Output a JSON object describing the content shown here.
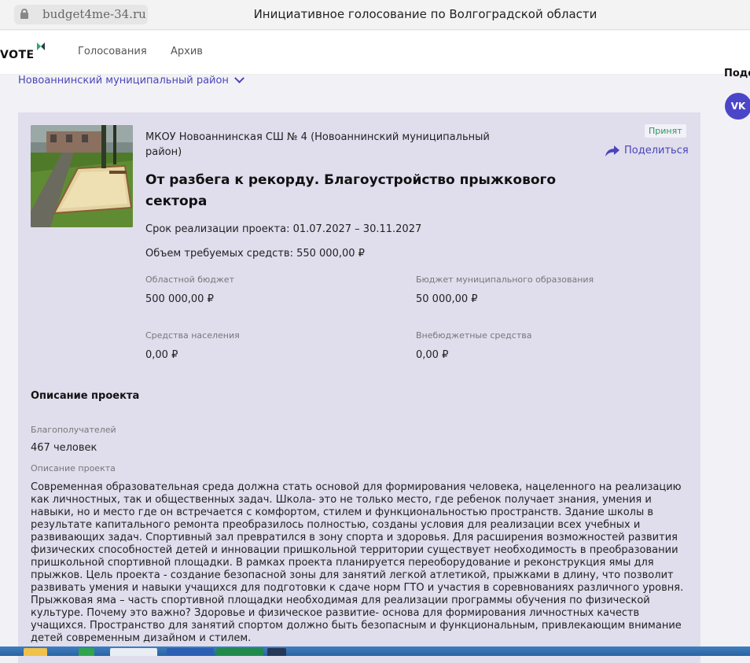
{
  "browser": {
    "url": "budget4me-34.ru",
    "page_title": "Инициативное голосование по Волгоградской области"
  },
  "site": {
    "logo": "VOTE",
    "nav": [
      "Голосования",
      "Архив"
    ],
    "side_heading": "Подел",
    "vk_label": "VK"
  },
  "filter": {
    "district": "Новоаннинский муниципальный район"
  },
  "project": {
    "organization": "МКОУ Новоаннинская СШ № 4 (Новоаннинский муниципальный район)",
    "status": "Принят",
    "share_label": "Поделиться",
    "title": "От разбега к рекорду. Благоустройство прыжкового сектора",
    "term": "Срок реализации проекта: 01.07.2027 – 30.11.2027",
    "volume": "Объем требуемых средств: 550 000,00 ₽",
    "funding": [
      {
        "label": "Областной бюджет",
        "value": "500 000,00 ₽"
      },
      {
        "label": "Бюджет муниципального образования",
        "value": "50 000,00 ₽"
      },
      {
        "label": "Средства населения",
        "value": "0,00 ₽"
      },
      {
        "label": "Внебюджетные средства",
        "value": "0,00 ₽"
      }
    ],
    "description_heading": "Описание проекта",
    "beneficiaries_label": "Благополучателей",
    "beneficiaries_value": "467 человек",
    "description_label": "Описание проекта",
    "description": "Современная образовательная среда должна стать основой для формирования человека, нацеленного на реализацию как личностных, так и общественных задач. Школа- это не только место, где ребенок получает знания, умения и навыки, но и место где он встречается с комфортом, стилем и функциональностью пространств. Здание школы в результате капитального ремонта преобразилось полностью, созданы условия для реализации всех учебных и развивающих задач. Спортивный зал превратился в зону спорта и здоровья. Для расширения возможностей развития физических способностей детей и инновации пришкольной территории существует необходимость в преобразовании пришкольной спортивной площадки. В рамках проекта планируется переоборудование и реконструкция ямы для прыжков. Цель проекта - создание безопасной зоны для занятий легкой атлетикой, прыжками в длину, что позволит развивать умения и навыки учащихся для подготовки к сдаче норм ГТО и участия в соревнованиях различного уровня. Прыжковая яма – часть спортивной площадки необходимая для реализации программы обучения по физической культуре. Почему это важно? Здоровье и физическое развитие- основа для формирования личностных качеств учащихся. Пространство для занятий спортом должно быть безопасным и функциональным, привлекающим внимание детей современным дизайном и стилем."
  },
  "colors": {
    "accent": "#4a45b8",
    "card_bg": "#e0dded",
    "status_green": "#2a9a5a"
  }
}
